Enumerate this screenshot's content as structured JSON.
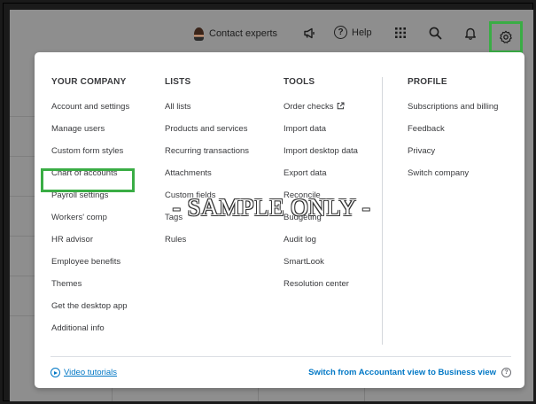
{
  "topbar": {
    "contact_label": "Contact experts",
    "help_label": "Help",
    "help_glyph": "?"
  },
  "columns": {
    "company": {
      "heading": "YOUR COMPANY",
      "items": [
        "Account and settings",
        "Manage users",
        "Custom form styles",
        "Chart of accounts",
        "Payroll settings",
        "Workers' comp",
        "HR advisor",
        "Employee benefits",
        "Themes",
        "Get the desktop app",
        "Additional info"
      ]
    },
    "lists": {
      "heading": "LISTS",
      "items": [
        "All lists",
        "Products and services",
        "Recurring transactions",
        "Attachments",
        "Custom fields",
        "Tags",
        "Rules"
      ]
    },
    "tools": {
      "heading": "TOOLS",
      "items": [
        "Order checks",
        "Import data",
        "Import desktop data",
        "Export data",
        "Reconcile",
        "Budgeting",
        "Audit log",
        "SmartLook",
        "Resolution center"
      ]
    },
    "profile": {
      "heading": "PROFILE",
      "items": [
        "Subscriptions and billing",
        "Feedback",
        "Privacy",
        "Switch company"
      ]
    }
  },
  "footer": {
    "video_label": "Video tutorials",
    "switch_label": "Switch from Accountant view to Business view",
    "help_glyph": "?"
  },
  "watermark": "- SAMPLE ONLY -",
  "colors": {
    "highlight": "#3aad45",
    "link": "#0077c5"
  }
}
